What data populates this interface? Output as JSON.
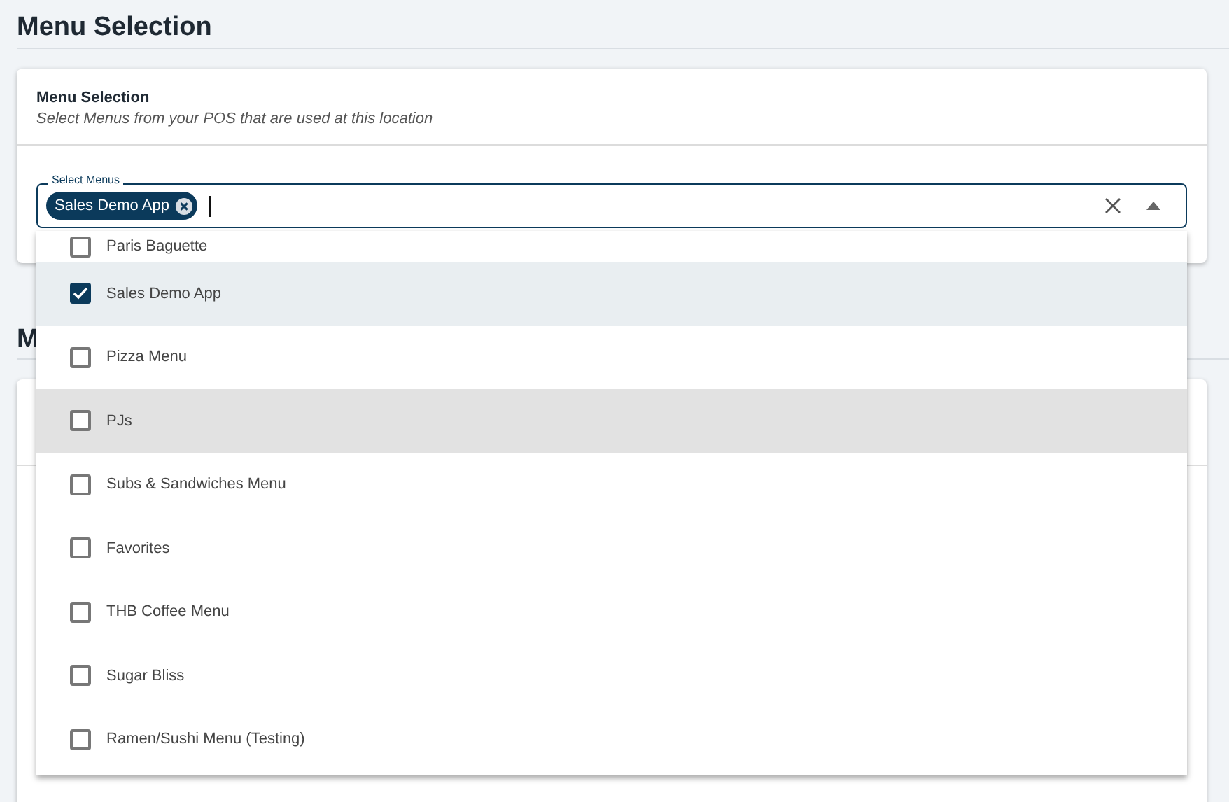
{
  "page": {
    "title": "Menu Selection"
  },
  "card": {
    "title": "Menu Selection",
    "subtitle": "Select Menus from your POS that are used at this location"
  },
  "select": {
    "label": "Select Menus",
    "chips": [
      "Sales Demo App"
    ],
    "expanded": true
  },
  "options": [
    {
      "label": "Paris Baguette",
      "checked": false,
      "selected": false,
      "hovered": false
    },
    {
      "label": "Sales Demo App",
      "checked": true,
      "selected": true,
      "hovered": false
    },
    {
      "label": "Pizza Menu",
      "checked": false,
      "selected": false,
      "hovered": false
    },
    {
      "label": "PJs",
      "checked": false,
      "selected": false,
      "hovered": true
    },
    {
      "label": "Subs & Sandwiches Menu",
      "checked": false,
      "selected": false,
      "hovered": false
    },
    {
      "label": "Favorites",
      "checked": false,
      "selected": false,
      "hovered": false
    },
    {
      "label": "THB Coffee Menu",
      "checked": false,
      "selected": false,
      "hovered": false
    },
    {
      "label": "Sugar Bliss",
      "checked": false,
      "selected": false,
      "hovered": false
    },
    {
      "label": "Ramen/Sushi Menu (Testing)",
      "checked": false,
      "selected": false,
      "hovered": false
    }
  ],
  "section2": {
    "title": "M"
  }
}
